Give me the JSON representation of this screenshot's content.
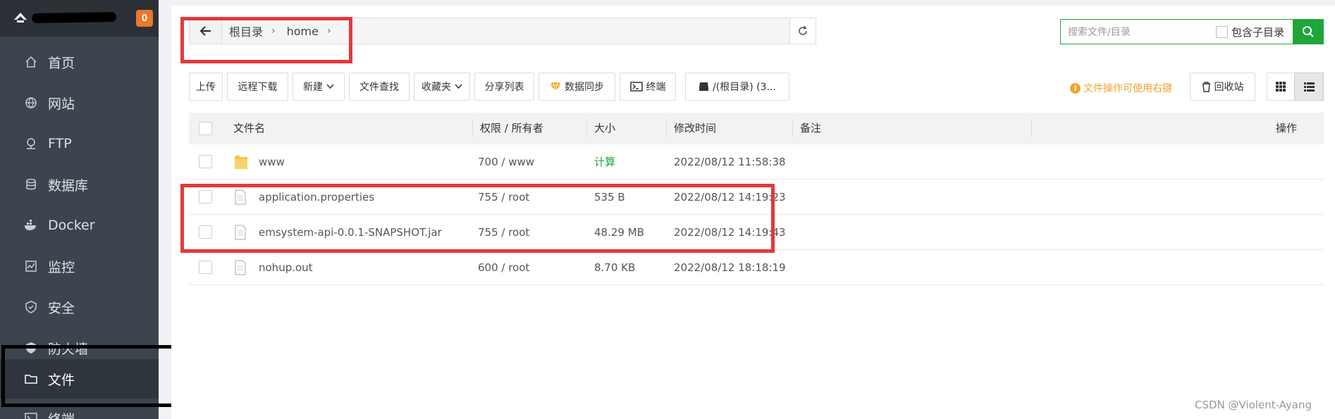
{
  "sidebar": {
    "badge": "0",
    "items": [
      {
        "label": "首页",
        "icon": "home-icon"
      },
      {
        "label": "网站",
        "icon": "globe-icon"
      },
      {
        "label": "FTP",
        "icon": "ftp-icon"
      },
      {
        "label": "数据库",
        "icon": "database-icon"
      },
      {
        "label": "Docker",
        "icon": "docker-icon"
      },
      {
        "label": "监控",
        "icon": "monitor-icon"
      },
      {
        "label": "安全",
        "icon": "shield-icon"
      },
      {
        "label": "防火墙",
        "icon": "firewall-icon"
      },
      {
        "label": "文件",
        "icon": "folder-icon",
        "active": true
      },
      {
        "label": "终端",
        "icon": "terminal-icon"
      }
    ]
  },
  "pathbar": {
    "crumbs": [
      "根目录",
      "home"
    ]
  },
  "search": {
    "placeholder": "搜索文件/目录",
    "subdir_label": "包含子目录"
  },
  "toolbar": {
    "upload": "上传",
    "remote_download": "远程下载",
    "new": "新建",
    "file_search": "文件查找",
    "favorites": "收藏夹",
    "share_list": "分享列表",
    "data_sync": "数据同步",
    "terminal": "终端",
    "disk": "/(根目录) (3...",
    "tip": "文件操作可使用右键",
    "recycle": "回收站"
  },
  "table": {
    "headers": {
      "name": "文件名",
      "perm": "权限 / 所有者",
      "size": "大小",
      "mtime": "修改时间",
      "note": "备注",
      "ops": "操作"
    },
    "rows": [
      {
        "type": "folder",
        "name": "www",
        "perm": "700 / www",
        "size": "计算",
        "mtime": "2022/08/12 11:58:38"
      },
      {
        "type": "file",
        "name": "application.properties",
        "perm": "755 / root",
        "size": "535 B",
        "mtime": "2022/08/12 14:19:23"
      },
      {
        "type": "file",
        "name": "emsystem-api-0.0.1-SNAPSHOT.jar",
        "perm": "755 / root",
        "size": "48.29 MB",
        "mtime": "2022/08/12 14:19:43"
      },
      {
        "type": "file",
        "name": "nohup.out",
        "perm": "600 / root",
        "size": "8.70 KB",
        "mtime": "2022/08/12 18:18:19"
      }
    ]
  },
  "watermark": "CSDN @Violent-Ayang",
  "colors": {
    "accent_green": "#20a53a",
    "badge_orange": "#f0762d",
    "highlight_red": "#e4393c",
    "tip_orange": "#f0a52d",
    "sidebar_bg": "#3c444d"
  }
}
